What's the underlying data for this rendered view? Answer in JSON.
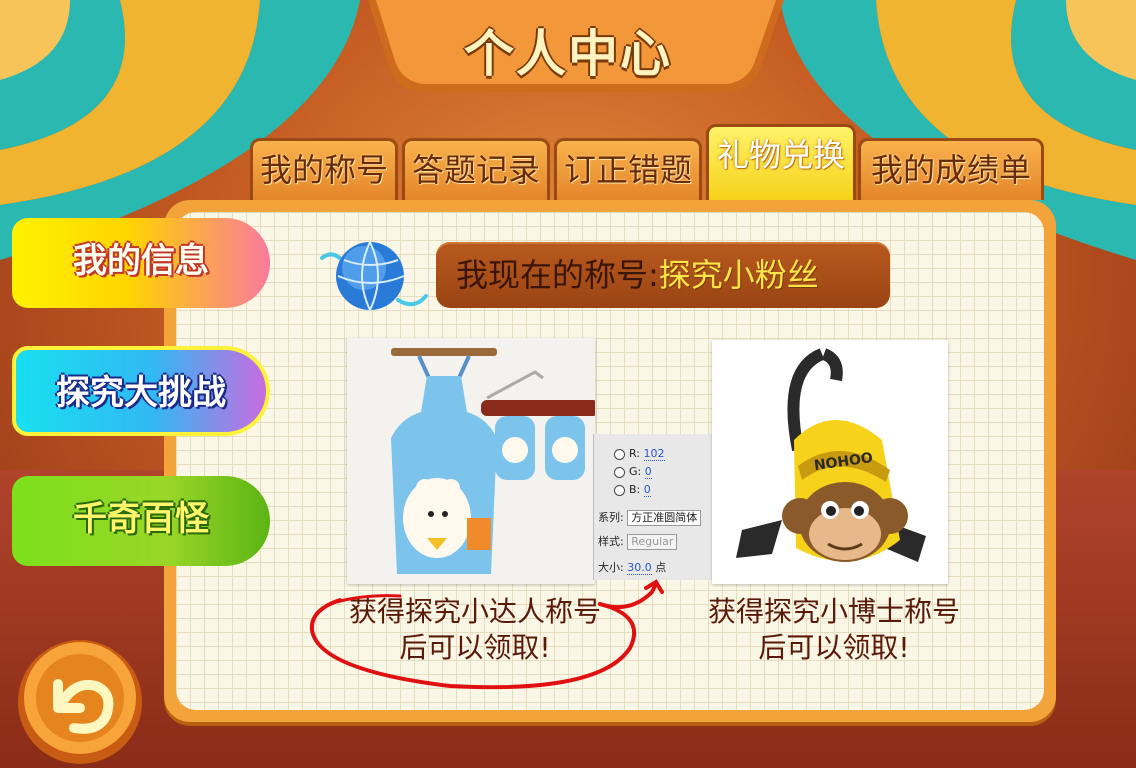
{
  "header": {
    "title": "个人中心"
  },
  "tabs": [
    {
      "label": "我的称号",
      "active": false
    },
    {
      "label": "答题记录",
      "active": false
    },
    {
      "label": "订正错题",
      "active": false
    },
    {
      "label": "礼物兑换",
      "active": true
    },
    {
      "label": "我的成绩单",
      "active": false
    }
  ],
  "sidebar": {
    "items": [
      {
        "label": "我的信息"
      },
      {
        "label": "探究大挑战"
      },
      {
        "label": "千奇百怪"
      }
    ]
  },
  "current_title": {
    "prefix": "我现在的称号:",
    "value": "探究小粉丝"
  },
  "rewards": [
    {
      "caption_line1": "获得探究小达人称号",
      "caption_line2": "后可以领取!",
      "image": "blue-apron-and-sleeves"
    },
    {
      "caption_line1": "获得探究小博士称号",
      "caption_line2": "后可以领取!",
      "image": "yellow-monkey-backpack"
    }
  ],
  "overlay_panel": {
    "r_label": "R:",
    "r_value": "102",
    "g_label": "G:",
    "g_value": "0",
    "b_label": "B:",
    "b_value": "0",
    "family_label": "系列:",
    "family_value": "方正准圆简体",
    "style_label": "样式:",
    "style_value": "Regular",
    "size_label": "大小:",
    "size_value": "30.0",
    "size_unit": "点"
  },
  "icons": {
    "back": "back-arrow-icon",
    "globe": "globe-icon"
  },
  "colors": {
    "active_tab": "#f6d21a",
    "tab": "#e4852a",
    "board_frame": "#f2a33a",
    "title_pill": "#a84c16",
    "annotation_ink": "#e01010"
  }
}
